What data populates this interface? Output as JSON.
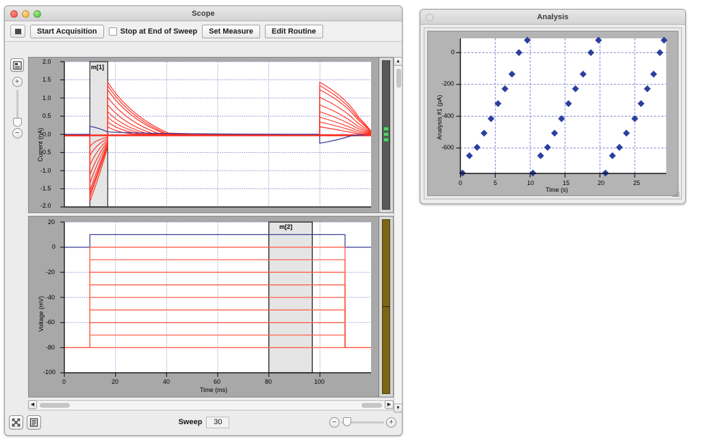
{
  "scope_window": {
    "title": "Scope",
    "traffic_lights": [
      "close",
      "minimize",
      "zoom"
    ],
    "toolbar": {
      "stop_button_icon": "stop-square-icon",
      "start_acquisition_label": "Start Acquisition",
      "stop_at_end_checkbox_label": "Stop at End of Sweep",
      "stop_at_end_checked": false,
      "set_measure_label": "Set Measure",
      "edit_routine_label": "Edit Routine"
    },
    "left_rail": {
      "config_icon": "chart-config-icon",
      "zoom_in_label": "+",
      "zoom_out_label": "−"
    },
    "footer": {
      "fit_icon": "fit-to-window-icon",
      "list_icon": "list-notes-icon",
      "sweep_label": "Sweep",
      "sweep_value": "30",
      "zoom_out_label": "−",
      "zoom_in_label": "+"
    },
    "gain_top": {
      "style": "dark",
      "segments": 3,
      "segment_color": "#57cf6a"
    },
    "gain_bottom": {
      "style": "olive",
      "color": "#7d6417"
    }
  },
  "analysis_window": {
    "title": "Analysis",
    "traffic_lights": [
      "close-disabled"
    ]
  },
  "chart_data": [
    {
      "id": "current-trace",
      "type": "line",
      "title": "",
      "xlabel": "",
      "ylabel": "Current (nA)",
      "xlim": [
        0,
        120
      ],
      "ylim": [
        -2.0,
        2.0
      ],
      "xticks": [
        0,
        20,
        40,
        60,
        80,
        100
      ],
      "yticks": [
        2.0,
        1.5,
        1.0,
        0.5,
        0.0,
        -0.5,
        -1.0,
        -1.5,
        -2.0
      ],
      "ytick_labels": [
        "2.0",
        "1.5",
        "1.0",
        "0.5",
        "0.0",
        "-0.5",
        "-1.0",
        "-1.5",
        "-2.0"
      ],
      "grid": true,
      "grid_color": "#8f8fd8",
      "cursor": {
        "label": "m[1]",
        "x_start": 10,
        "x_end": 17
      },
      "series": [
        {
          "name": "sweep-control",
          "color": "#3b3b9e",
          "peak_on": 0.22,
          "peak_off": -0.28,
          "steady": 0.0
        },
        {
          "name": "sweep-1",
          "color": "#ff3b2f",
          "peak_on": -0.16,
          "peak_off": 0.22,
          "steady": -0.015
        },
        {
          "name": "sweep-2",
          "color": "#ff3b2f",
          "peak_on": -0.3,
          "peak_off": 0.35,
          "steady": -0.02
        },
        {
          "name": "sweep-3",
          "color": "#ff3b2f",
          "peak_on": -0.46,
          "peak_off": 0.5,
          "steady": -0.025
        },
        {
          "name": "sweep-4",
          "color": "#ff3b2f",
          "peak_on": -0.64,
          "peak_off": 0.66,
          "steady": -0.03
        },
        {
          "name": "sweep-5",
          "color": "#ff3b2f",
          "peak_on": -0.84,
          "peak_off": 0.85,
          "steady": -0.035
        },
        {
          "name": "sweep-6",
          "color": "#ff3b2f",
          "peak_on": -1.06,
          "peak_off": 1.05,
          "steady": -0.04
        },
        {
          "name": "sweep-7",
          "color": "#ff3b2f",
          "peak_on": -1.28,
          "peak_off": 1.25,
          "steady": -0.045
        },
        {
          "name": "sweep-8",
          "color": "#ff3b2f",
          "peak_on": -1.5,
          "peak_off": 1.45,
          "steady": -0.05
        },
        {
          "name": "sweep-9",
          "color": "#ff3b2f",
          "peak_on": -1.66,
          "peak_off": 1.62,
          "steady": -0.055
        }
      ]
    },
    {
      "id": "voltage-command",
      "type": "line",
      "title": "",
      "xlabel": "Time (ms)",
      "ylabel": "Voltage (mV)",
      "xlim": [
        0,
        120
      ],
      "ylim": [
        -100,
        20
      ],
      "xticks": [
        0,
        20,
        40,
        60,
        80,
        100
      ],
      "xtick_labels": [
        "0",
        "20",
        "40",
        "60",
        "80",
        "100"
      ],
      "yticks": [
        20,
        0,
        -20,
        -40,
        -60,
        -80,
        -100
      ],
      "ytick_labels": [
        "20",
        "0",
        "-20",
        "-40",
        "-60",
        "-80",
        "-100"
      ],
      "grid": true,
      "grid_color": "#8f8fd8",
      "cursor": {
        "label": "m[2]",
        "x_start": 80,
        "x_end": 97
      },
      "pulse": {
        "start_ms": 10,
        "end_ms": 110,
        "holding_mv": -80
      },
      "series": [
        {
          "name": "step-control",
          "color": "#3b3b9e",
          "level_mv": 10
        },
        {
          "name": "step-1",
          "color": "#ff6a55",
          "level_mv": 0
        },
        {
          "name": "step-2",
          "color": "#ff6a55",
          "level_mv": -10
        },
        {
          "name": "step-3",
          "color": "#ff6a55",
          "level_mv": -20
        },
        {
          "name": "step-4",
          "color": "#ff6a55",
          "level_mv": -30
        },
        {
          "name": "step-5",
          "color": "#ff5a45",
          "level_mv": -40
        },
        {
          "name": "step-6",
          "color": "#ff5a45",
          "level_mv": -50
        },
        {
          "name": "step-7",
          "color": "#ff5a45",
          "level_mv": -60
        },
        {
          "name": "step-8",
          "color": "#ff5a45",
          "level_mv": -70
        },
        {
          "name": "step-9",
          "color": "#ff5a45",
          "level_mv": -80
        }
      ]
    },
    {
      "id": "analysis-scatter",
      "type": "scatter",
      "title": "",
      "xlabel": "Time (s)",
      "ylabel": "Analysis #1 (pA)",
      "xlim": [
        0,
        29.5
      ],
      "ylim": [
        -760,
        90
      ],
      "xticks": [
        0,
        5,
        10,
        15,
        20,
        25
      ],
      "xtick_labels": [
        "0",
        "5",
        "10",
        "15",
        "20",
        "25"
      ],
      "yticks": [
        0,
        -200,
        -400,
        -600
      ],
      "ytick_labels": [
        "0",
        "-200",
        "-400",
        "-600"
      ],
      "grid": true,
      "grid_color": "#8f8fd8",
      "marker": "diamond",
      "marker_color": "#2b3f9e",
      "marker_size": 6,
      "points": [
        {
          "x": 0.3,
          "y": -757
        },
        {
          "x": 1.3,
          "y": -648
        },
        {
          "x": 2.4,
          "y": -552
        },
        {
          "x": 3.4,
          "y": -463
        },
        {
          "x": 4.4,
          "y": -372
        },
        {
          "x": 5.4,
          "y": -277
        },
        {
          "x": 6.4,
          "y": -184
        },
        {
          "x": 7.4,
          "y": -92
        },
        {
          "x": 8.4,
          "y": 0
        },
        {
          "x": 9.6,
          "y": 78
        },
        {
          "x": 10.4,
          "y": -757
        },
        {
          "x": 11.5,
          "y": -648
        },
        {
          "x": 12.5,
          "y": -552
        },
        {
          "x": 13.5,
          "y": -463
        },
        {
          "x": 14.5,
          "y": -372
        },
        {
          "x": 15.5,
          "y": -277
        },
        {
          "x": 16.5,
          "y": -184
        },
        {
          "x": 17.6,
          "y": -92
        },
        {
          "x": 18.7,
          "y": 0
        },
        {
          "x": 19.8,
          "y": 78
        },
        {
          "x": 20.8,
          "y": -757
        },
        {
          "x": 21.8,
          "y": -648
        },
        {
          "x": 22.8,
          "y": -552
        },
        {
          "x": 23.8,
          "y": -463
        },
        {
          "x": 25.0,
          "y": -372
        },
        {
          "x": 25.9,
          "y": -277
        },
        {
          "x": 26.8,
          "y": -184
        },
        {
          "x": 27.7,
          "y": -92
        },
        {
          "x": 28.6,
          "y": 0
        },
        {
          "x": 29.2,
          "y": 78
        }
      ]
    }
  ]
}
